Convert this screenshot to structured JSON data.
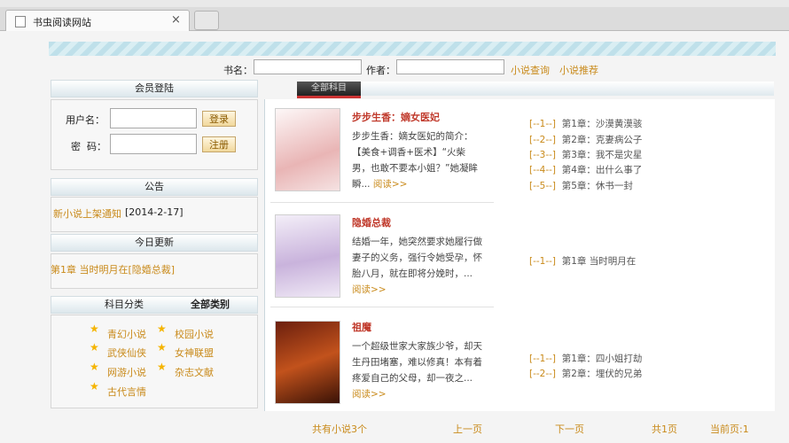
{
  "browser": {
    "tab_title": "书虫阅读网站",
    "tab_close": "×"
  },
  "search": {
    "title_label": "书名：",
    "author_label": "作者：",
    "query_link": "小说查询",
    "recommend_link": "小说推荐"
  },
  "login": {
    "header": "会员登陆",
    "username_label": "用户名：",
    "password_label": "密  码：",
    "login_button": "登录",
    "register_button": "注册"
  },
  "notice": {
    "header": "公告",
    "item": "新小说上架通知",
    "date": "[2014-2-17]"
  },
  "today": {
    "header": "今日更新",
    "item": "第1章 当时明月在[隐婚总裁]"
  },
  "categories": {
    "header": "科目分类",
    "all_label": "全部类别",
    "items": [
      "青幻小说",
      "校园小说",
      "武侠仙侠",
      "女神联盟",
      "网游小说",
      "杂志文献",
      "古代言情"
    ]
  },
  "main": {
    "tab_label": "全部科目"
  },
  "books": [
    {
      "title": "步步生香：嫡女医妃",
      "desc": "步步生香：嫡女医妃的简介：【美食+调香+医术】“火柴男，也敢不要本小姐？”她凝眸瞬...",
      "more": "阅读>>",
      "chapters": [
        {
          "idx": "[--1--]",
          "name": "第1章：沙漠黄漠骇"
        },
        {
          "idx": "[--2--]",
          "name": "第2章：克妻病公子"
        },
        {
          "idx": "[--3--]",
          "name": "第3章：我不是灾星"
        },
        {
          "idx": "[--4--]",
          "name": "第4章：出什么事了"
        },
        {
          "idx": "[--5--]",
          "name": "第5章：休书一封"
        }
      ]
    },
    {
      "title": "隐婚总裁",
      "desc": "结婚一年，她突然要求她履行做妻子的义务，强行令她受孕，怀胎八月，就在即将分娩时，...",
      "more": "阅读>>",
      "chapters": [
        {
          "idx": "[--1--]",
          "name": "第1章 当时明月在"
        }
      ]
    },
    {
      "title": "祖魔",
      "desc": "一个超级世家大家族少爷，却天生丹田堵塞，难以修真！本有着疼爱自己的父母，却一夜之...",
      "more": "阅读>>",
      "chapters": [
        {
          "idx": "[--1--]",
          "name": "第1章：四小姐打劫"
        },
        {
          "idx": "[--2--]",
          "name": "第2章：埋伏的兄弟"
        }
      ]
    }
  ],
  "pager": {
    "total": "共有小说3个",
    "prev": "上一页",
    "next": "下一页",
    "pages": "共1页",
    "current": "当前页:1"
  }
}
